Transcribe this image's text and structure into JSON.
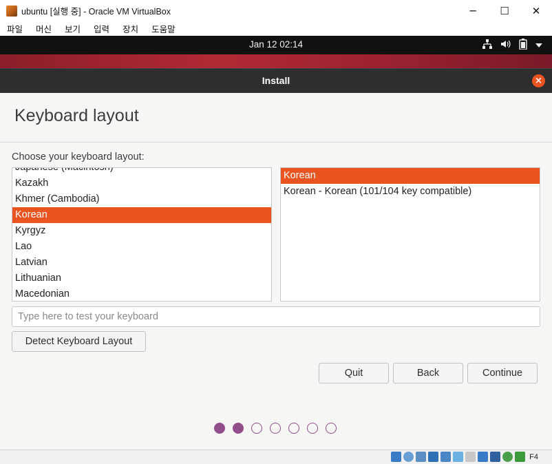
{
  "window": {
    "title": "ubuntu [실행 중] - Oracle VM VirtualBox",
    "minimize": "─",
    "maximize": "☐",
    "close": "✕"
  },
  "menu": [
    "파일",
    "머신",
    "보기",
    "입력",
    "장치",
    "도움말"
  ],
  "topbar": {
    "clock": "Jan 12  02:14",
    "icons": [
      "network-icon",
      "volume-icon",
      "battery-icon",
      "menu-arrow-icon"
    ]
  },
  "installer": {
    "title": "Install",
    "page_title": "Keyboard layout",
    "prompt": "Choose your keyboard layout:",
    "layouts": [
      "Kazakh",
      "Khmer (Cambodia)",
      "Korean",
      "Kyrgyz",
      "Lao",
      "Latvian",
      "Lithuanian",
      "Macedonian"
    ],
    "layout_above_partial": "Japanese (Macintosh)",
    "selected_layout": "Korean",
    "variants": [
      "Korean",
      "Korean - Korean (101/104 key compatible)"
    ],
    "selected_variant": "Korean",
    "test_placeholder": "Type here to test your keyboard",
    "detect_button": "Detect Keyboard Layout",
    "quit_button": "Quit",
    "back_button": "Back",
    "continue_button": "Continue",
    "progress": {
      "total_steps": 7,
      "completed_steps": 2
    }
  },
  "statusbar": {
    "host_key": "F4",
    "colors": {
      "accent": "#e95420",
      "progress": "#924d8b"
    }
  }
}
